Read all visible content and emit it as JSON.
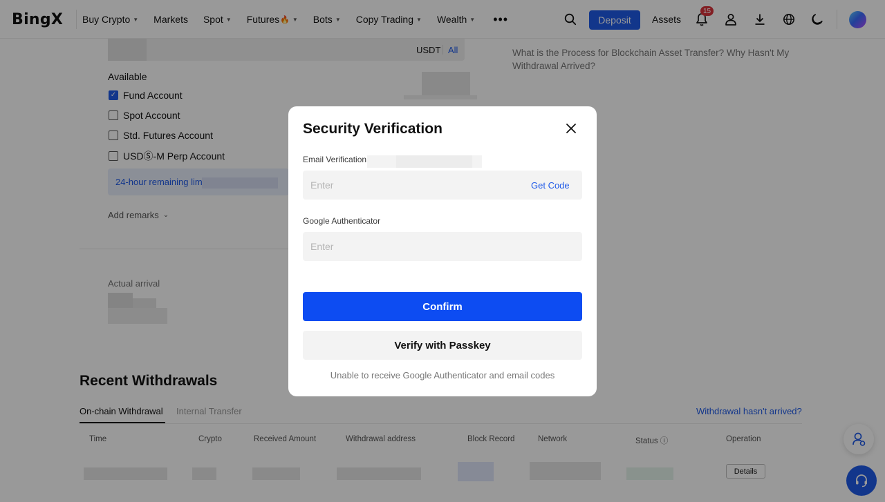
{
  "header": {
    "logo": "BingX",
    "nav": [
      {
        "label": "Buy Crypto",
        "caret": true
      },
      {
        "label": "Markets",
        "caret": false
      },
      {
        "label": "Spot",
        "caret": true
      },
      {
        "label": "Futures",
        "caret": true,
        "emoji": "🔥"
      },
      {
        "label": "Bots",
        "caret": true
      },
      {
        "label": "Copy Trading",
        "caret": true
      },
      {
        "label": "Wealth",
        "caret": true
      }
    ],
    "more_icon": "more-dots-icon",
    "deposit_label": "Deposit",
    "assets_label": "Assets",
    "notification_count": "15"
  },
  "withdraw_form": {
    "currency": "USDT",
    "all_label": "All",
    "available_label": "Available",
    "accounts": [
      {
        "label": "Fund Account",
        "checked": true
      },
      {
        "label": "Spot Account",
        "checked": false
      },
      {
        "label": "Std. Futures Account",
        "checked": false
      },
      {
        "label": "USDⓈ-M Perp Account",
        "checked": false
      }
    ],
    "limit_label": "24-hour remaining limit",
    "add_remarks_label": "Add remarks",
    "actual_arrival_label": "Actual arrival"
  },
  "faq": {
    "text": "What is the Process for Blockchain Asset Transfer? Why Hasn't My Withdrawal Arrived?"
  },
  "recent": {
    "title": "Recent Withdrawals",
    "tabs": [
      "On-chain Withdrawal",
      "Internal Transfer"
    ],
    "arrived_link": "Withdrawal hasn't arrived?",
    "columns": [
      "Time",
      "Crypto",
      "Received Amount",
      "Withdrawal address",
      "Block Record",
      "Network",
      "Status ⓘ",
      "Operation"
    ],
    "details_label": "Details"
  },
  "modal": {
    "title": "Security Verification",
    "email_label": "Email Verification",
    "email_placeholder": "Enter",
    "get_code_label": "Get Code",
    "google_label": "Google Authenticator",
    "google_placeholder": "Enter",
    "confirm_label": "Confirm",
    "passkey_label": "Verify with Passkey",
    "unable_text": "Unable to receive Google Authenticator and email codes"
  },
  "colors": {
    "accent": "#1f5ae8",
    "confirm": "#0d4cf2",
    "badge": "#d9323b"
  }
}
